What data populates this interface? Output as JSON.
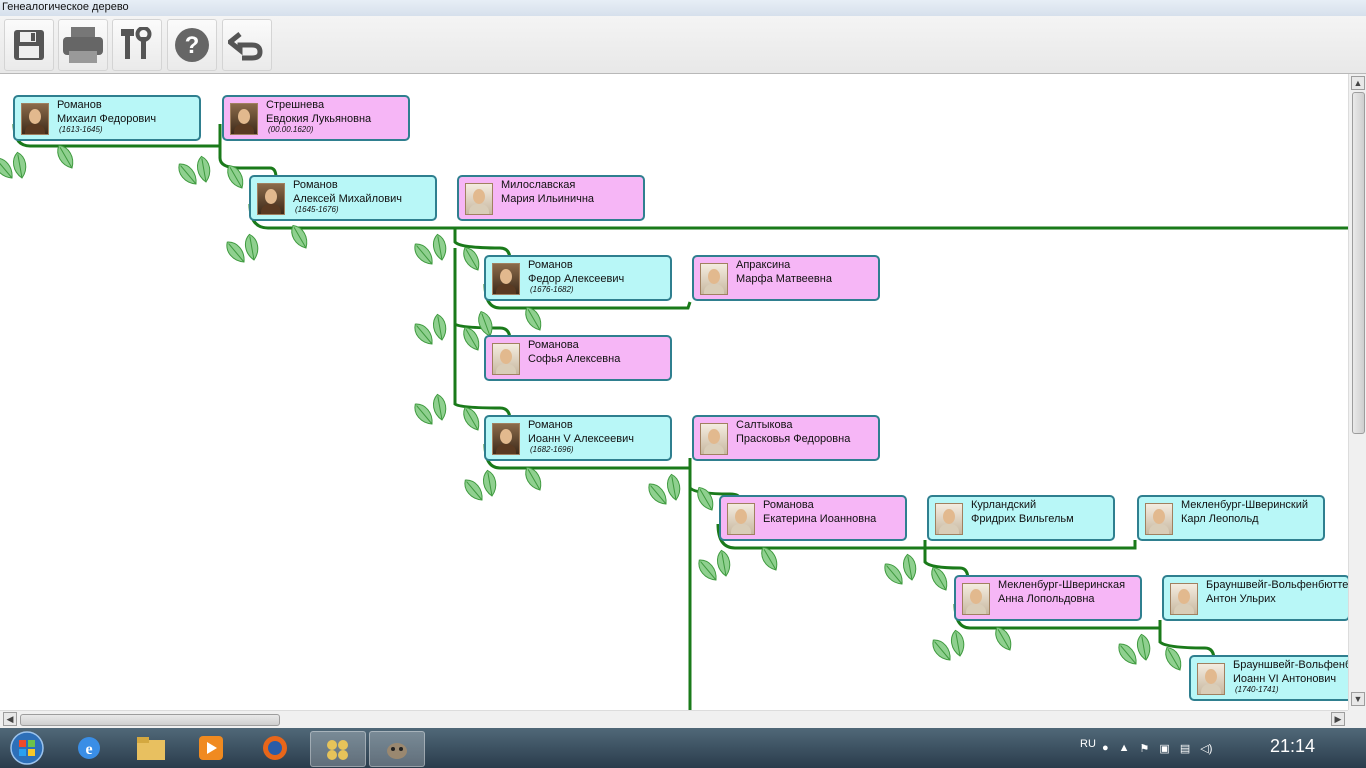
{
  "window": {
    "title": "Генеалогическое дерево"
  },
  "toolbar": {
    "buttons": [
      {
        "name": "save",
        "icon": "floppy-disk-icon"
      },
      {
        "name": "print",
        "icon": "printer-icon"
      },
      {
        "name": "settings",
        "icon": "tools-icon"
      },
      {
        "name": "help",
        "icon": "question-icon"
      },
      {
        "name": "undo",
        "icon": "undo-arrow-icon"
      }
    ]
  },
  "tree": {
    "colors": {
      "male": "#b8f7f7",
      "female": "#f6b6f6",
      "line": "#1a7a1a"
    },
    "persons": [
      {
        "surname": "Романов",
        "name": "Михаил Федорович",
        "dates": "(1613-1645)",
        "sex": "m"
      },
      {
        "surname": "Стрешнева",
        "name": "Евдокия Лукьяновна",
        "dates": "(00.00.1620)",
        "sex": "f"
      },
      {
        "surname": "Романов",
        "name": "Алексей Михайлович",
        "dates": "(1645-1676)",
        "sex": "m"
      },
      {
        "surname": "Милославская",
        "name": "Мария Ильинична",
        "dates": "",
        "sex": "f"
      },
      {
        "surname": "Романов",
        "name": "Федор Алексеевич",
        "dates": "(1676-1682)",
        "sex": "m"
      },
      {
        "surname": "Апраксина",
        "name": "Марфа Матвеевна",
        "dates": "",
        "sex": "f"
      },
      {
        "surname": "Романова",
        "name": "Софья Алексевна",
        "dates": "",
        "sex": "f"
      },
      {
        "surname": "Романов",
        "name": "Иоанн V Алексеевич",
        "dates": "(1682-1696)",
        "sex": "m"
      },
      {
        "surname": "Салтыкова",
        "name": "Прасковья Федоровна",
        "dates": "",
        "sex": "f"
      },
      {
        "surname": "Романова",
        "name": "Екатерина Иоанновна",
        "dates": "",
        "sex": "f"
      },
      {
        "surname": "Курландский",
        "name": "Фридрих Вильгельм",
        "dates": "",
        "sex": "m"
      },
      {
        "surname": "Мекленбург-Шверинский",
        "name": "Карл Леопольд",
        "dates": "",
        "sex": "m"
      },
      {
        "surname": "Мекленбург-Шверинская",
        "name": "Анна Лопольдовна",
        "dates": "",
        "sex": "f"
      },
      {
        "surname": "Брауншвейг-Вольфенбюттель",
        "name": "Антон Ульрих",
        "dates": "",
        "sex": "m"
      },
      {
        "surname": "Брауншвейг-Вольфенбюттель",
        "name": "Иоанн VI Антонович",
        "dates": "(1740-1741)",
        "sex": "m"
      }
    ]
  },
  "taskbar": {
    "apps": [
      "windows-start-icon",
      "internet-explorer-icon",
      "explorer-folder-icon",
      "media-player-icon",
      "firefox-icon",
      "tree-app-icon",
      "gimp-icon"
    ],
    "language": "RU",
    "clock": "21:14"
  }
}
